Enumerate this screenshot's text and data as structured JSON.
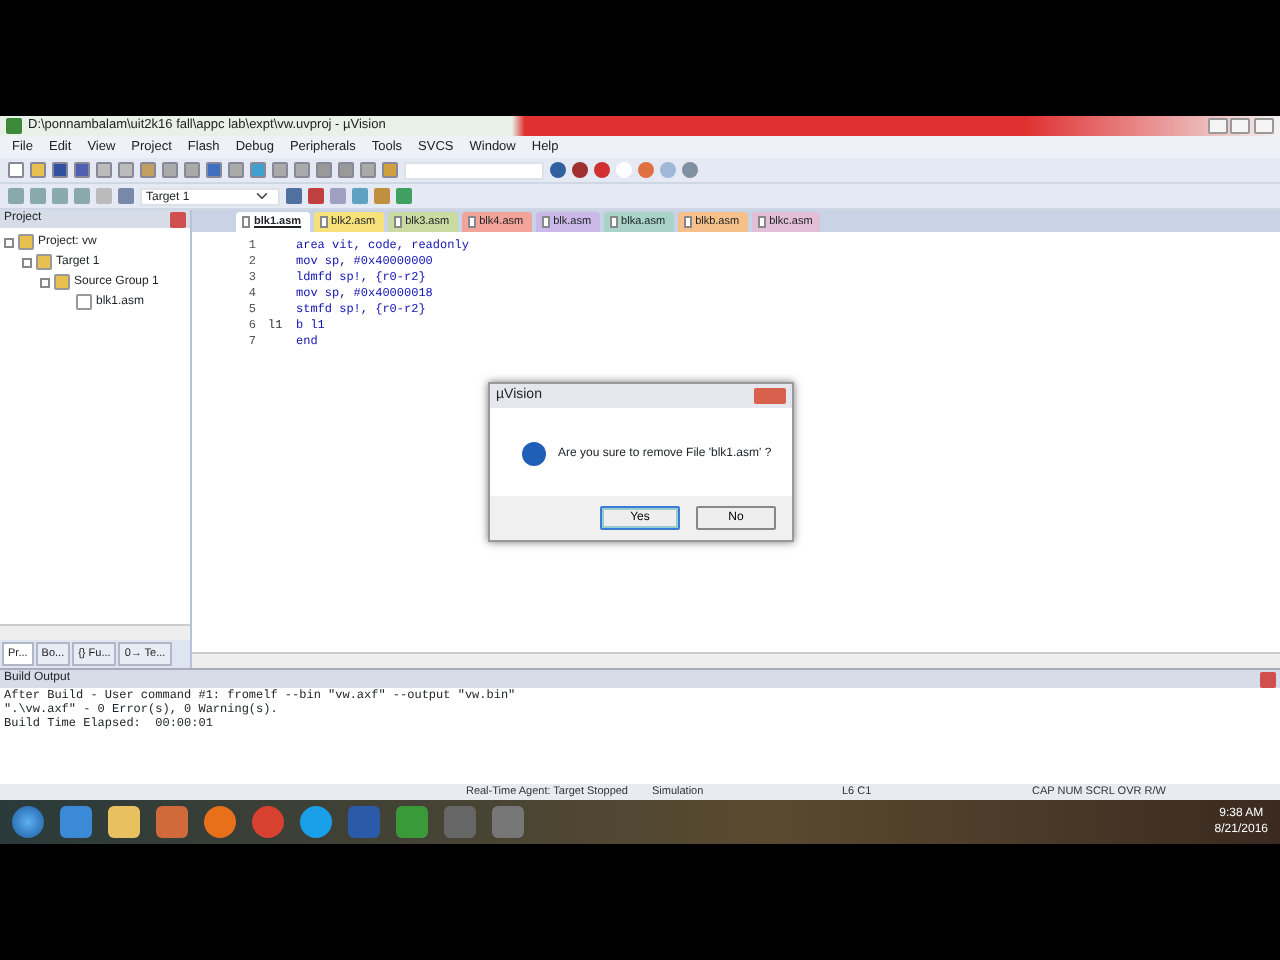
{
  "window": {
    "title": "D:\\ponnambalam\\uit2k16 fall\\appc lab\\expt\\vw.uvproj - µVision"
  },
  "menu": [
    "File",
    "Edit",
    "View",
    "Project",
    "Flash",
    "Debug",
    "Peripherals",
    "Tools",
    "SVCS",
    "Window",
    "Help"
  ],
  "toolbar": {
    "target": "Target 1"
  },
  "project_panel": {
    "title": "Project",
    "tree": [
      {
        "label": "Project: vw",
        "expanded": true,
        "children": [
          {
            "label": "Target 1",
            "expanded": true,
            "children": [
              {
                "label": "Source Group 1",
                "expanded": true,
                "children": [
                  {
                    "label": "blk1.asm"
                  }
                ]
              }
            ]
          }
        ]
      }
    ],
    "tabs": [
      {
        "label": "Pr...",
        "selected": true
      },
      {
        "label": "Bo...",
        "selected": false
      },
      {
        "label": "{} Fu...",
        "selected": false
      },
      {
        "label": "0→ Te...",
        "selected": false
      }
    ]
  },
  "editor_tabs": [
    {
      "label": "blk1.asm",
      "selected": true,
      "color": "#ffffff"
    },
    {
      "label": "blk2.asm",
      "selected": false,
      "color": "#f7e27a"
    },
    {
      "label": "blk3.asm",
      "selected": false,
      "color": "#c9dba0"
    },
    {
      "label": "blk4.asm",
      "selected": false,
      "color": "#f2a39a"
    },
    {
      "label": "blk.asm",
      "selected": false,
      "color": "#c9b8e8"
    },
    {
      "label": "blka.asm",
      "selected": false,
      "color": "#a9d3c6"
    },
    {
      "label": "blkb.asm",
      "selected": false,
      "color": "#f6c08a"
    },
    {
      "label": "blkc.asm",
      "selected": false,
      "color": "#e2bfd6"
    }
  ],
  "code_lines": [
    {
      "number": "1",
      "code": "area vit, code, readonly"
    },
    {
      "number": "2",
      "code": "mov sp, #0x40000000"
    },
    {
      "number": "3",
      "code": "ldmfd sp!, {r0-r2}"
    },
    {
      "number": "4",
      "code": "mov sp, #0x40000018"
    },
    {
      "number": "5",
      "code": "stmfd sp!, {r0-r2}"
    },
    {
      "number": "6",
      "label": "l1",
      "code": "b l1"
    },
    {
      "number": "7",
      "code": "end"
    }
  ],
  "dialog": {
    "title": "µVision",
    "message": "Are you sure to remove File 'blk1.asm' ?",
    "buttons": [
      {
        "label": "Yes",
        "selected": true
      },
      {
        "label": "No",
        "selected": false
      }
    ]
  },
  "build_output": {
    "title": "Build Output",
    "lines": [
      "After Build - User command #1: fromelf --bin \"vw.axf\" --output \"vw.bin\"",
      "\".\\vw.axf\" - 0 Error(s), 0 Warning(s).",
      "Build Time Elapsed:  00:00:01"
    ]
  },
  "status_bar": [
    "Real-Time Agent: Target Stopped",
    "Simulation",
    "L6 C1",
    "CAP NUM SCRL OVR R/W"
  ],
  "taskbar": {
    "time": "9:38 AM",
    "date": "8/21/2016"
  }
}
